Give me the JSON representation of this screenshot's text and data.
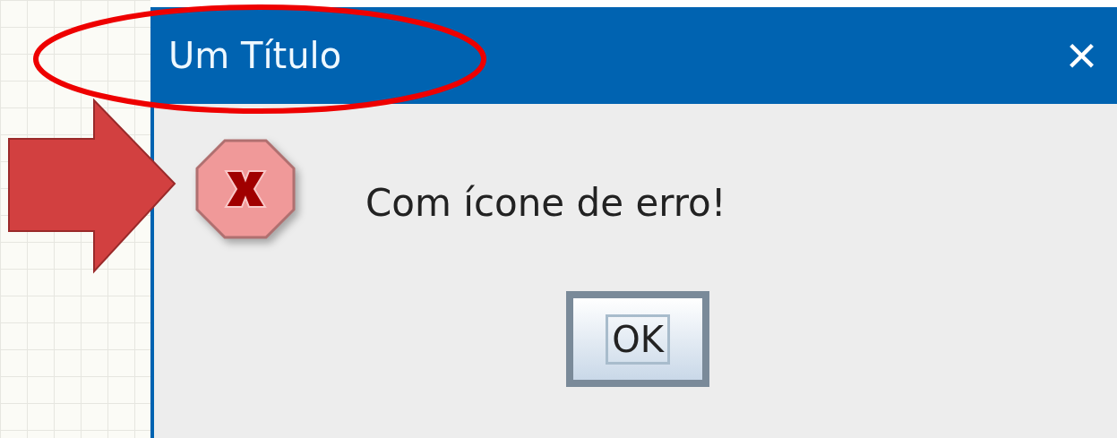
{
  "window": {
    "title": "Um Título",
    "close": "×"
  },
  "message": {
    "kind": "error",
    "text": "Com ícone de erro!"
  },
  "buttons": [
    {
      "label": "OK",
      "focused": true
    }
  ]
}
